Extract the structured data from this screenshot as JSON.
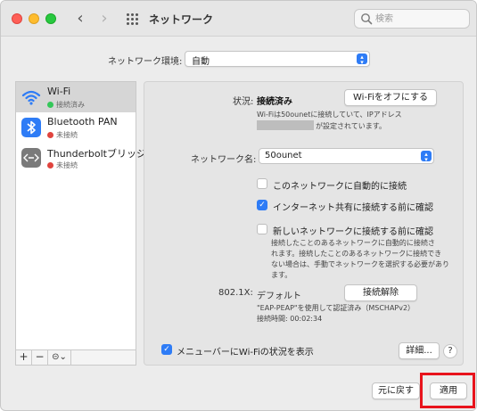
{
  "window": {
    "title": "ネットワーク"
  },
  "search": {
    "placeholder": "検索"
  },
  "location": {
    "label": "ネットワーク環境:",
    "value": "自動"
  },
  "services": [
    {
      "name": "Wi-Fi",
      "status": "接続済み",
      "status_color": "#34c759",
      "selected": true
    },
    {
      "name": "Bluetooth PAN",
      "status": "未接続",
      "status_color": "#e0443e",
      "selected": false
    },
    {
      "name": "Thunderboltブリッジ",
      "status": "未接続",
      "status_color": "#e0443e",
      "selected": false
    }
  ],
  "sidebar_controls": {
    "add": "+",
    "remove": "−",
    "action": "⊝⌄"
  },
  "detail": {
    "status_label": "状況:",
    "status_value": "接続済み",
    "wifi_off_button": "Wi-Fiをオフにする",
    "status_desc_line1": "Wi-Fiは50ounetに接続していて、IPアドレス",
    "status_desc_line2": "が設定されています。",
    "network_name_label": "ネットワーク名:",
    "network_name_value": "50ounet",
    "opt_auto_join": "このネットワークに自動的に接続",
    "opt_auto_join_checked": false,
    "opt_ask_hotspot": "インターネット共有に接続する前に確認",
    "opt_ask_hotspot_checked": true,
    "opt_ask_new": "新しいネットワークに接続する前に確認",
    "opt_ask_new_checked": false,
    "ask_new_desc_1": "接続したことのあるネットワークに自動的に接続さ",
    "ask_new_desc_2": "れます。接続したことのあるネットワークに接続でき",
    "ask_new_desc_3": "ない場合は、手動でネットワークを選択する必要があり",
    "ask_new_desc_4": "ます。",
    "dot1x_label": "802.1X:",
    "dot1x_value": "デフォルト",
    "disconnect_button": "接続解除",
    "dot1x_desc_1": "\"EAP-PEAP\"を使用して認証済み（MSCHAPv2）",
    "dot1x_desc_2": "接続時間: 00:02:34"
  },
  "menubar_option": {
    "label": "メニューバーにWi-Fiの状況を表示",
    "checked": true
  },
  "advanced_button": "詳細...",
  "help_button": "?",
  "revert_button": "元に戻す",
  "apply_button": "適用",
  "colors": {
    "accent": "#2e7cf6",
    "highlight": "#e8131c"
  }
}
